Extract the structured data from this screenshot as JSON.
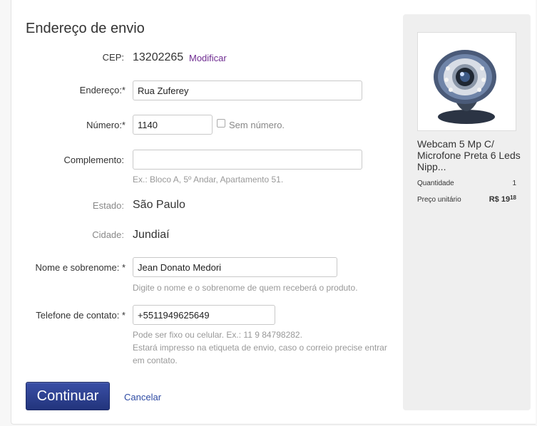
{
  "page_title": "Endereço de envio",
  "form": {
    "cep": {
      "label": "CEP:",
      "value": "13202265",
      "modify_link": "Modificar"
    },
    "endereco": {
      "label": "Endereço:*",
      "value": "Rua Zuferey"
    },
    "numero": {
      "label": "Número:*",
      "value": "1140",
      "no_number_label": "Sem número."
    },
    "complemento": {
      "label": "Complemento:",
      "value": "",
      "hint": "Ex.: Bloco A, 5º Andar, Apartamento 51."
    },
    "estado": {
      "label": "Estado:",
      "value": "São Paulo"
    },
    "cidade": {
      "label": "Cidade:",
      "value": "Jundiaí"
    },
    "nome": {
      "label": "Nome e sobrenome: *",
      "value": "Jean Donato Medori",
      "hint": "Digite o nome e o sobrenome de quem receberá o produto."
    },
    "telefone": {
      "label": "Telefone de contato: *",
      "value": "+5511949625649",
      "hint_line1": "Pode ser fixo ou celular. Ex.: 11 9 84798282.",
      "hint_line2": "Estará impresso na etiqueta de envio, caso o correio precise entrar",
      "hint_line3": "em contato."
    }
  },
  "actions": {
    "continue_label": "Continuar",
    "cancel_label": "Cancelar"
  },
  "summary": {
    "product_name": "Webcam 5 Mp C/ Microfone Preta 6 Leds Nipp...",
    "quantity_label": "Quantidade",
    "quantity_value": "1",
    "unit_price_label": "Preço unitário",
    "unit_price_main": "R$ 19",
    "unit_price_cents": "18",
    "image_icon": "webcam-image"
  },
  "colors": {
    "button": "#2c3e8c",
    "link_purple": "#6f2c91",
    "link_blue": "#2d4aa3",
    "sidebar_bg": "#efefef"
  }
}
